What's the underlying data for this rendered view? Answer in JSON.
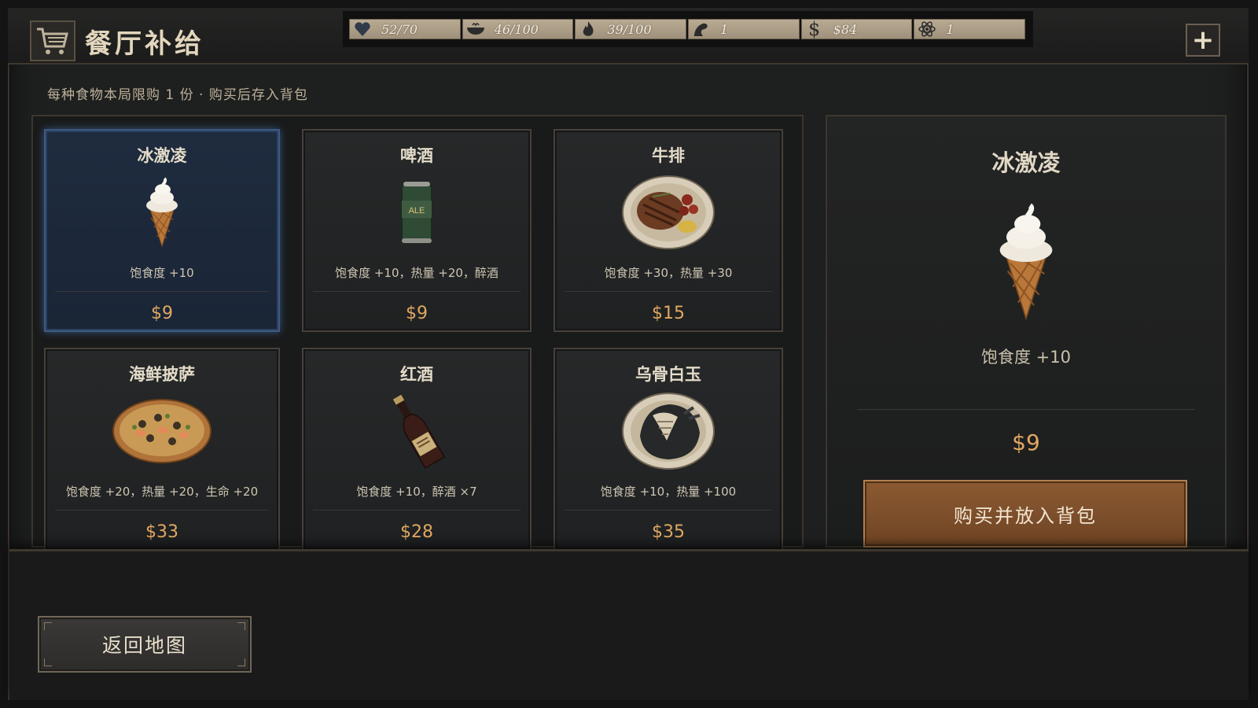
{
  "header": {
    "title": "餐厅补给",
    "cart_icon": "cart-icon",
    "plus_label": "+"
  },
  "stats": [
    {
      "icon": "heart-icon",
      "value": "52/70"
    },
    {
      "icon": "bowl-icon",
      "value": "46/100"
    },
    {
      "icon": "flame-icon",
      "value": "39/100"
    },
    {
      "icon": "stamina-icon",
      "value": "1"
    },
    {
      "icon": "dollar-icon",
      "value": "$84"
    },
    {
      "icon": "atom-icon",
      "value": "1"
    }
  ],
  "subtitle": "每种食物本局限购 1 份 · 购买后存入背包",
  "items": [
    {
      "name": "冰激凌",
      "effect": "饱食度 +10",
      "price": "$9",
      "icon": "ice-cream-icon",
      "selected": true
    },
    {
      "name": "啤酒",
      "effect": "饱食度 +10，热量 +20，醉酒",
      "price": "$9",
      "icon": "beer-can-icon",
      "can_text": "ALE"
    },
    {
      "name": "牛排",
      "effect": "饱食度 +30，热量 +30",
      "price": "$15",
      "icon": "steak-icon"
    },
    {
      "name": "海鲜披萨",
      "effect": "饱食度 +20，热量 +20，生命 +20",
      "price": "$33",
      "icon": "pizza-icon"
    },
    {
      "name": "红酒",
      "effect": "饱食度 +10，醉酒 ×7",
      "price": "$28",
      "icon": "wine-bottle-icon"
    },
    {
      "name": "乌骨白玉",
      "effect": "饱食度 +10，热量 +100",
      "price": "$35",
      "icon": "black-chicken-icon"
    }
  ],
  "detail": {
    "name": "冰激凌",
    "effect": "饱食度 +10",
    "price": "$9",
    "icon": "ice-cream-icon",
    "buy_label": "购买并放入背包"
  },
  "back_label": "返回地图",
  "colors": {
    "price": "#e0a862",
    "selected_border": "#3e5a82",
    "buy_button": "#8b5a32"
  }
}
